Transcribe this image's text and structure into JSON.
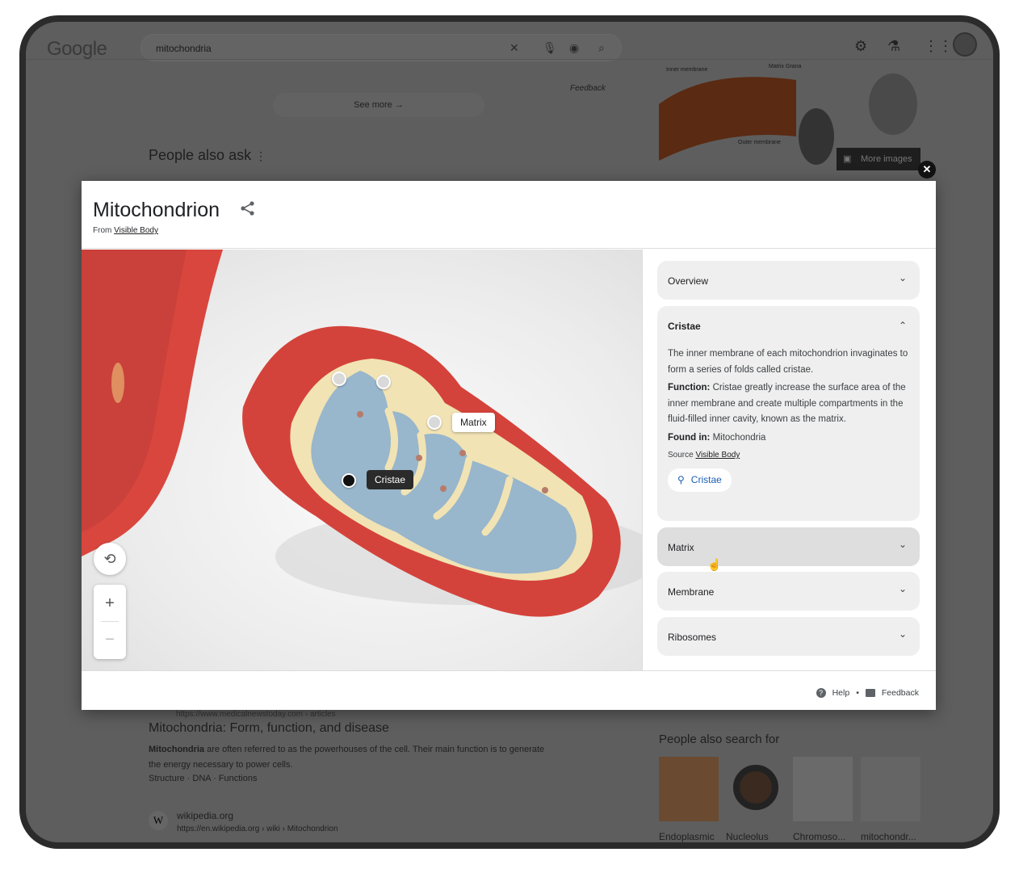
{
  "header": {
    "logo": "Google",
    "query": "mitochondria",
    "icons": [
      "clear-icon",
      "mic-icon",
      "lens-icon",
      "search-icon",
      "settings-icon",
      "labs-icon",
      "apps-icon",
      "avatar"
    ]
  },
  "background": {
    "feedback": "Feedback",
    "see_more": "See more",
    "people_also_ask": "People also ask",
    "more_images": "More images",
    "result": {
      "url": "https://www.medicalnewstoday.com › articles",
      "title": "Mitochondria: Form, function, and disease",
      "snippet_bold": "Mitochondria",
      "snippet": " are often referred to as the powerhouses of the cell. Their main function is to generate the energy necessary to power cells.",
      "links": "Structure · DNA · Functions"
    },
    "wiki": {
      "icon": "W",
      "site": "wikipedia.org",
      "url": "https://en.wikipedia.org › wiki › Mitochondrion"
    },
    "people_also_search": {
      "title": "People also search for",
      "items": [
        "Endoplasmic",
        "Nucleolus",
        "Chromoso...",
        "mitochondr..."
      ]
    },
    "diagram_labels": [
      "Inner membrane",
      "Matrix Grana",
      "Outer membrane"
    ]
  },
  "modal": {
    "title": "Mitochondrion",
    "from_label": "From",
    "from_source": "Visible Body",
    "model_labels": {
      "matrix": "Matrix",
      "cristae": "Cristae"
    },
    "zoom_in": "+",
    "zoom_out": "−",
    "accordion": [
      {
        "label": "Overview",
        "expanded": false
      },
      {
        "label": "Cristae",
        "expanded": true,
        "text": "The inner membrane of each mitochondrion invaginates to form a series of folds called cristae.",
        "function_label": "Function:",
        "function_text": " Cristae greatly increase the surface area of the inner membrane and create multiple compartments in the fluid-filled inner cavity, known as the matrix.",
        "found_label": "Found in:",
        "found_text": " Mitochondria",
        "source_label": "Source",
        "source_link": "Visible Body",
        "search_chip": "Cristae"
      },
      {
        "label": "Matrix",
        "expanded": false
      },
      {
        "label": "Membrane",
        "expanded": false
      },
      {
        "label": "Ribosomes",
        "expanded": false
      }
    ],
    "footer": {
      "help": "Help",
      "separator": "•",
      "feedback": "Feedback"
    }
  }
}
